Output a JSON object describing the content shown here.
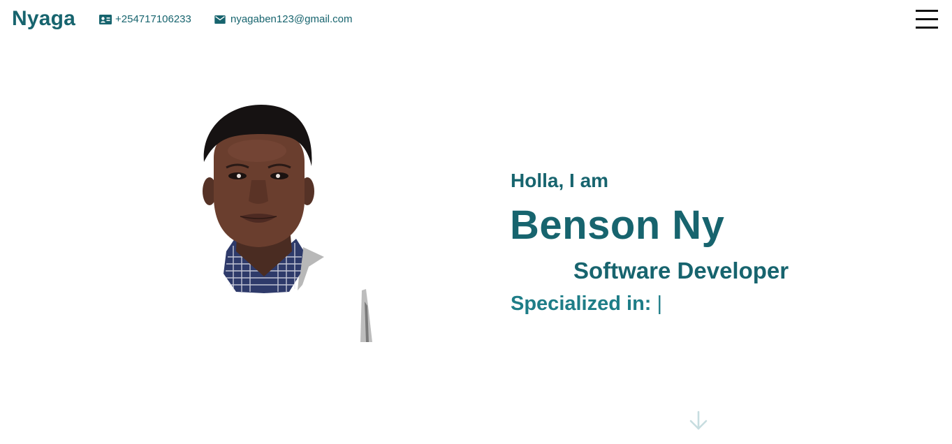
{
  "header": {
    "brand": "Nyaga",
    "phone": "+254717106233",
    "email": "nyagaben123@gmail.com",
    "phone_icon": "contact-card-icon",
    "email_icon": "envelope-icon",
    "menu_icon": "hamburger-menu-icon"
  },
  "hero": {
    "greeting": "Holla, I am",
    "name": "Benson Ny",
    "role": "Software Developer",
    "specialized_label": "Specialized in:",
    "cursor": "|",
    "portrait_icon": "profile-photo",
    "scroll_icon": "arrow-down-icon"
  },
  "colors": {
    "primary": "#17646e",
    "accent": "#1e7d87",
    "arrow": "#c7dde0"
  }
}
